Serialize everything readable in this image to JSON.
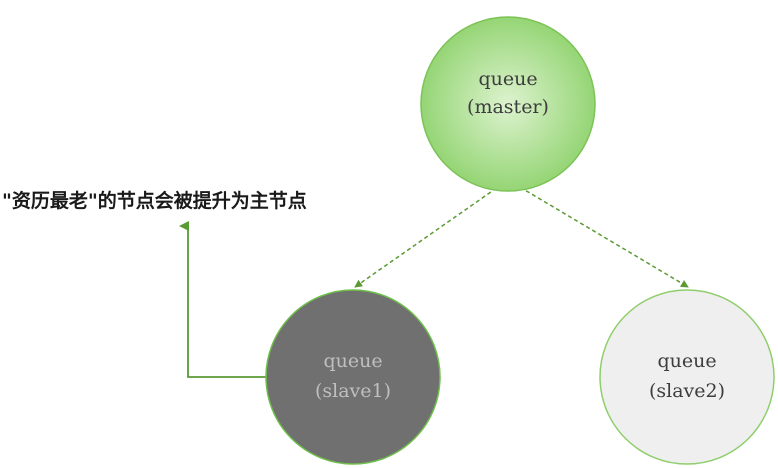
{
  "annotation": "\"资历最老\"的节点会被提升为主节点",
  "nodes": {
    "master": {
      "line1": "queue",
      "line2": "(master)"
    },
    "slave1": {
      "line1": "queue",
      "line2": "(slave1)"
    },
    "slave2": {
      "line1": "queue",
      "line2": "(slave2)"
    }
  },
  "colors": {
    "master_fill": "#a8dc8e",
    "master_stroke": "#6fbf4a",
    "slave1_fill": "#707070",
    "slave2_fill": "#eeeeee",
    "connector": "#5a9a32"
  }
}
